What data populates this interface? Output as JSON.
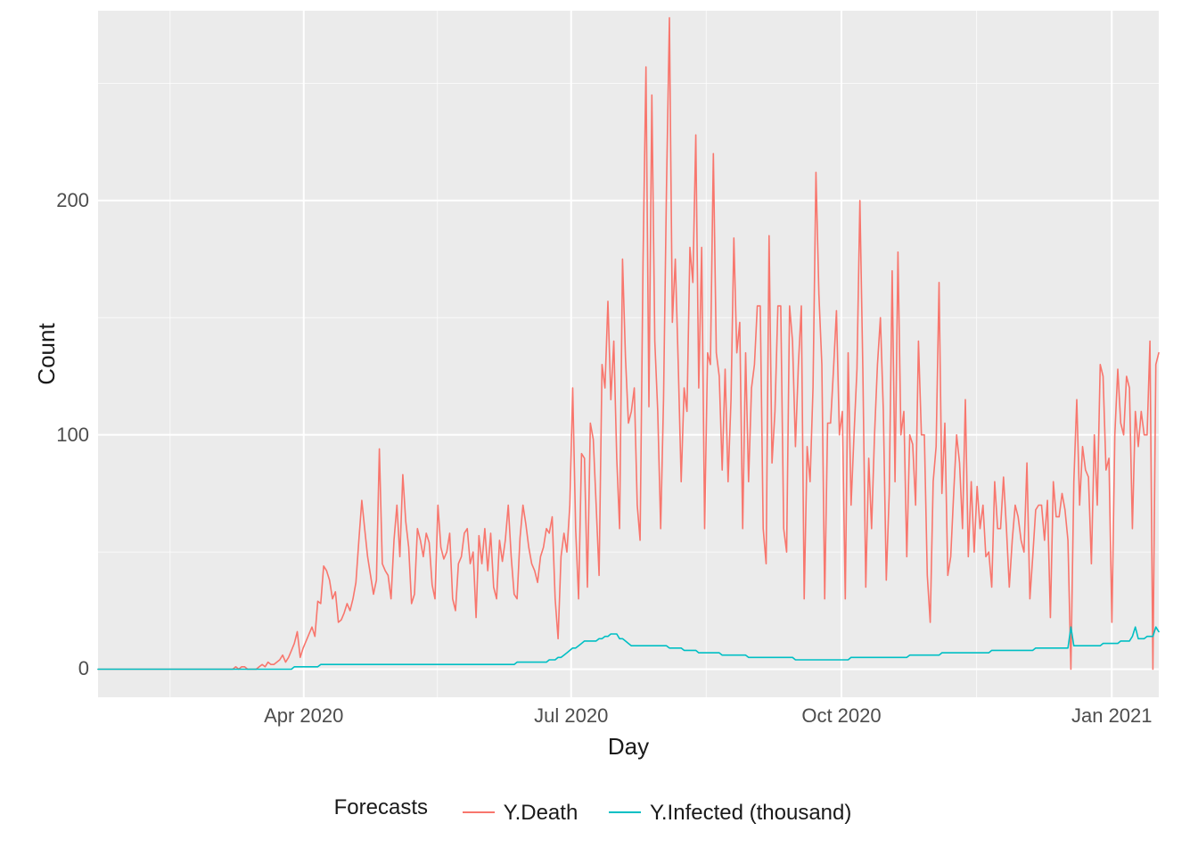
{
  "chart_data": {
    "type": "line",
    "xlabel": "Day",
    "ylabel": "Count",
    "ylim": [
      -12,
      281
    ],
    "x_start": "2020-01-22",
    "x_end": "2021-01-17",
    "x_ticks": [
      "Apr 2020",
      "Jul 2020",
      "Oct 2020",
      "Jan 2021"
    ],
    "x_tick_dates": [
      "2020-04-01",
      "2020-07-01",
      "2020-10-01",
      "2021-01-01"
    ],
    "y_ticks": [
      0,
      100,
      200
    ],
    "legend_title": "Forecasts",
    "colors": {
      "Y.Death": "#F8766D",
      "Y.Infected (thousand)": "#00BFC4"
    },
    "series": [
      {
        "name": "Y.Death",
        "values": [
          0,
          0,
          0,
          0,
          0,
          0,
          0,
          0,
          0,
          0,
          0,
          0,
          0,
          0,
          0,
          0,
          0,
          0,
          0,
          0,
          0,
          0,
          0,
          0,
          0,
          0,
          0,
          0,
          0,
          0,
          0,
          0,
          0,
          0,
          0,
          0,
          0,
          0,
          0,
          0,
          0,
          0,
          0,
          0,
          0,
          0,
          0,
          1,
          0,
          1,
          1,
          0,
          0,
          0,
          0,
          1,
          2,
          1,
          3,
          2,
          2,
          3,
          4,
          6,
          3,
          5,
          8,
          11,
          16,
          5,
          9,
          12,
          15,
          18,
          14,
          29,
          28,
          44,
          42,
          38,
          30,
          33,
          20,
          21,
          24,
          28,
          25,
          30,
          37,
          55,
          72,
          60,
          48,
          40,
          32,
          38,
          94,
          45,
          42,
          40,
          30,
          55,
          70,
          48,
          83,
          63,
          52,
          28,
          32,
          60,
          55,
          48,
          58,
          54,
          36,
          30,
          70,
          52,
          47,
          50,
          58,
          30,
          25,
          45,
          48,
          58,
          60,
          45,
          50,
          22,
          57,
          45,
          60,
          42,
          58,
          35,
          30,
          55,
          46,
          55,
          70,
          48,
          32,
          30,
          56,
          70,
          62,
          52,
          45,
          42,
          37,
          48,
          52,
          60,
          58,
          65,
          30,
          13,
          48,
          58,
          50,
          70,
          120,
          60,
          30,
          92,
          90,
          35,
          105,
          98,
          70,
          40,
          130,
          120,
          157,
          115,
          140,
          90,
          60,
          175,
          133,
          105,
          110,
          120,
          70,
          55,
          174,
          257,
          112,
          245,
          140,
          110,
          60,
          115,
          205,
          278,
          148,
          175,
          130,
          80,
          120,
          110,
          180,
          165,
          228,
          120,
          180,
          60,
          135,
          130,
          220,
          135,
          125,
          85,
          128,
          80,
          115,
          184,
          135,
          148,
          60,
          135,
          80,
          120,
          130,
          155,
          155,
          60,
          45,
          185,
          88,
          110,
          155,
          155,
          60,
          50,
          155,
          140,
          95,
          130,
          155,
          30,
          95,
          80,
          120,
          212,
          160,
          130,
          30,
          105,
          105,
          128,
          153,
          100,
          110,
          30,
          135,
          70,
          100,
          128,
          200,
          128,
          35,
          90,
          60,
          100,
          130,
          150,
          110,
          38,
          75,
          170,
          80,
          178,
          100,
          110,
          48,
          100,
          96,
          70,
          140,
          100,
          100,
          40,
          20,
          80,
          95,
          165,
          75,
          105,
          40,
          48,
          75,
          100,
          88,
          60,
          115,
          48,
          80,
          50,
          78,
          60,
          70,
          48,
          50,
          35,
          80,
          60,
          60,
          82,
          60,
          35,
          55,
          70,
          65,
          55,
          50,
          88,
          30,
          48,
          68,
          70,
          70,
          55,
          72,
          22,
          80,
          65,
          65,
          75,
          68,
          55,
          0,
          80,
          115,
          70,
          95,
          85,
          82,
          45,
          100,
          70,
          130,
          125,
          85,
          90,
          20,
          100,
          128,
          105,
          100,
          125,
          120,
          60,
          110,
          95,
          110,
          100,
          100,
          140,
          0,
          130,
          135
        ]
      },
      {
        "name": "Y.Infected (thousand)",
        "values": [
          0,
          0,
          0,
          0,
          0,
          0,
          0,
          0,
          0,
          0,
          0,
          0,
          0,
          0,
          0,
          0,
          0,
          0,
          0,
          0,
          0,
          0,
          0,
          0,
          0,
          0,
          0,
          0,
          0,
          0,
          0,
          0,
          0,
          0,
          0,
          0,
          0,
          0,
          0,
          0,
          0,
          0,
          0,
          0,
          0,
          0,
          0,
          0,
          0,
          0,
          0,
          0,
          0,
          0,
          0,
          0,
          0,
          0,
          0,
          0,
          0,
          0,
          0,
          0,
          0,
          0,
          0,
          1,
          1,
          1,
          1,
          1,
          1,
          1,
          1,
          1,
          2,
          2,
          2,
          2,
          2,
          2,
          2,
          2,
          2,
          2,
          2,
          2,
          2,
          2,
          2,
          2,
          2,
          2,
          2,
          2,
          2,
          2,
          2,
          2,
          2,
          2,
          2,
          2,
          2,
          2,
          2,
          2,
          2,
          2,
          2,
          2,
          2,
          2,
          2,
          2,
          2,
          2,
          2,
          2,
          2,
          2,
          2,
          2,
          2,
          2,
          2,
          2,
          2,
          2,
          2,
          2,
          2,
          2,
          2,
          2,
          2,
          2,
          2,
          2,
          2,
          2,
          2,
          3,
          3,
          3,
          3,
          3,
          3,
          3,
          3,
          3,
          3,
          3,
          4,
          4,
          4,
          5,
          5,
          6,
          7,
          8,
          9,
          9,
          10,
          11,
          12,
          12,
          12,
          12,
          12,
          13,
          13,
          14,
          14,
          15,
          15,
          15,
          13,
          13,
          12,
          11,
          10,
          10,
          10,
          10,
          10,
          10,
          10,
          10,
          10,
          10,
          10,
          10,
          10,
          9,
          9,
          9,
          9,
          9,
          8,
          8,
          8,
          8,
          8,
          7,
          7,
          7,
          7,
          7,
          7,
          7,
          7,
          6,
          6,
          6,
          6,
          6,
          6,
          6,
          6,
          6,
          5,
          5,
          5,
          5,
          5,
          5,
          5,
          5,
          5,
          5,
          5,
          5,
          5,
          5,
          5,
          5,
          4,
          4,
          4,
          4,
          4,
          4,
          4,
          4,
          4,
          4,
          4,
          4,
          4,
          4,
          4,
          4,
          4,
          4,
          4,
          5,
          5,
          5,
          5,
          5,
          5,
          5,
          5,
          5,
          5,
          5,
          5,
          5,
          5,
          5,
          5,
          5,
          5,
          5,
          5,
          6,
          6,
          6,
          6,
          6,
          6,
          6,
          6,
          6,
          6,
          6,
          7,
          7,
          7,
          7,
          7,
          7,
          7,
          7,
          7,
          7,
          7,
          7,
          7,
          7,
          7,
          7,
          7,
          8,
          8,
          8,
          8,
          8,
          8,
          8,
          8,
          8,
          8,
          8,
          8,
          8,
          8,
          8,
          9,
          9,
          9,
          9,
          9,
          9,
          9,
          9,
          9,
          9,
          9,
          9,
          18,
          10,
          10,
          10,
          10,
          10,
          10,
          10,
          10,
          10,
          10,
          11,
          11,
          11,
          11,
          11,
          11,
          12,
          12,
          12,
          12,
          14,
          18,
          13,
          13,
          13,
          14,
          14,
          14,
          18,
          16
        ]
      }
    ]
  }
}
